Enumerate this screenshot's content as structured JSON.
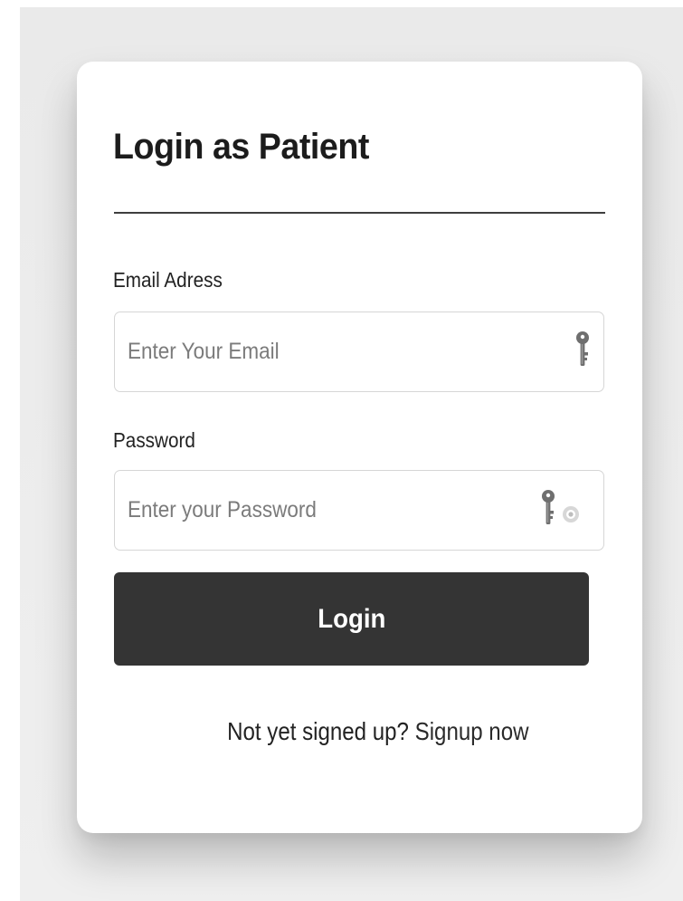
{
  "form": {
    "title": "Login as Patient",
    "email": {
      "label": "Email Adress",
      "placeholder": "Enter Your Email",
      "value": ""
    },
    "password": {
      "label": "Password",
      "placeholder": "Enter your Password",
      "value": ""
    },
    "login_label": "Login",
    "signup_prompt": "Not yet signed up?",
    "signup_link": "Signup now"
  },
  "icons": {
    "email_field_icon": "key-icon",
    "password_field_icon": "key-icon",
    "password_toggle_icon": "eye-icon"
  },
  "colors": {
    "button_bg": "#343434",
    "button_text": "#ffffff",
    "page_bg": "#ececec",
    "card_bg": "#ffffff",
    "text": "#222222"
  }
}
